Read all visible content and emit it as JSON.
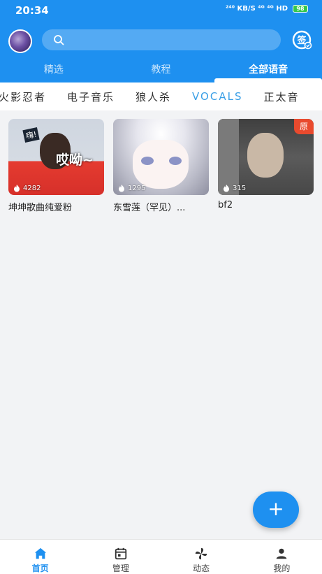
{
  "status_bar": {
    "time": "20:34",
    "indicators": "²⁴⁰ KB/S  ⁴ᴳ  ⁴ᴳ  HD",
    "battery": "98"
  },
  "search": {
    "placeholder": ""
  },
  "top_tabs": [
    {
      "label": "精选",
      "active": false
    },
    {
      "label": "教程",
      "active": false
    },
    {
      "label": "全部语音",
      "active": true
    }
  ],
  "category_tabs": [
    {
      "label": "火影忍者",
      "active": false
    },
    {
      "label": "电子音乐",
      "active": false
    },
    {
      "label": "狼人杀",
      "active": false
    },
    {
      "label": "VOCALS",
      "active": true
    },
    {
      "label": "正太音",
      "active": false
    }
  ],
  "cards": [
    {
      "title": "坤坤歌曲纯爱粉",
      "plays": "4282",
      "image_text": "哎呦~",
      "image_tag": "嗨!",
      "badge": ""
    },
    {
      "title": "东雪莲（罕见）...",
      "plays": "1295",
      "image_text": "",
      "image_tag": "",
      "badge": ""
    },
    {
      "title": "bf2",
      "plays": "315",
      "image_text": "",
      "image_tag": "",
      "badge": "原"
    }
  ],
  "fab": {
    "label": "+"
  },
  "bottom_nav": [
    {
      "label": "首页",
      "icon": "home-icon",
      "active": true
    },
    {
      "label": "管理",
      "icon": "calendar-icon",
      "active": false
    },
    {
      "label": "动态",
      "icon": "pinwheel-icon",
      "active": false
    },
    {
      "label": "我的",
      "icon": "person-icon",
      "active": false
    }
  ],
  "colors": {
    "primary": "#1e90f0",
    "accent_text": "#3a9fe6",
    "badge": "#e94a2e"
  }
}
